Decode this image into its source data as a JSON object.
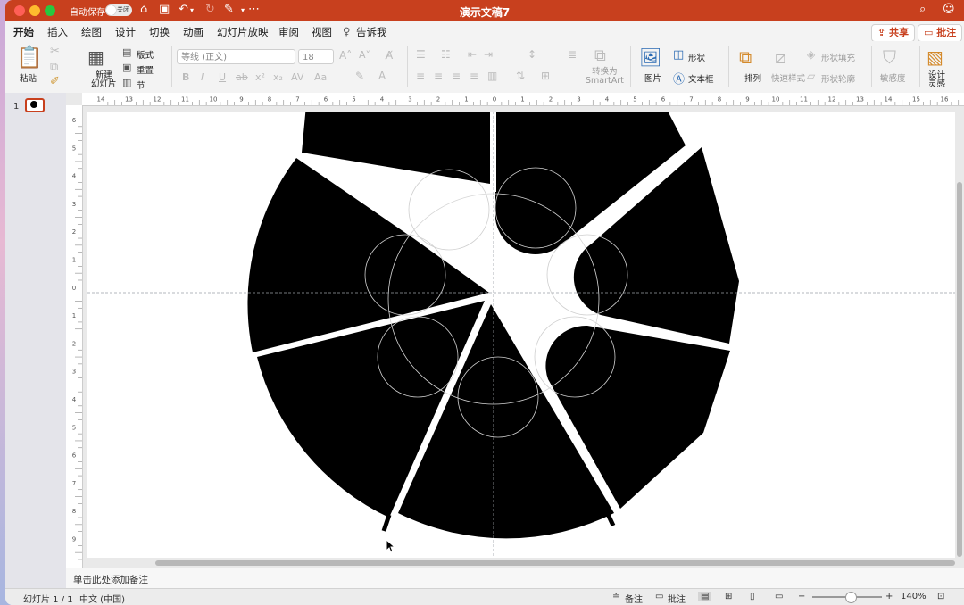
{
  "titlebar": {
    "autosave_label": "自动保存",
    "autosave_state": "关闭",
    "doc_title": "演示文稿7"
  },
  "tabs": [
    {
      "label": "开始",
      "active": true
    },
    {
      "label": "插入"
    },
    {
      "label": "绘图"
    },
    {
      "label": "设计"
    },
    {
      "label": "切换"
    },
    {
      "label": "动画"
    },
    {
      "label": "幻灯片放映"
    },
    {
      "label": "审阅"
    },
    {
      "label": "视图"
    },
    {
      "label": "告诉我"
    }
  ],
  "actions": {
    "share": "共享",
    "comment": "批注"
  },
  "ribbon": {
    "paste": "粘贴",
    "new_slide_1": "新建",
    "new_slide_2": "幻灯片",
    "layout": "版式",
    "reset": "重置",
    "section": "节",
    "font_name": "等线 (正文)",
    "font_size": "18",
    "convert_1": "转换为",
    "convert_2": "SmartArt",
    "picture": "图片",
    "shape": "形状",
    "textbox": "文本框",
    "arrange": "排列",
    "quick_styles": "快速样式",
    "shape_fill": "形状填充",
    "shape_outline": "形状轮廓",
    "sensitivity": "敏感度",
    "designer_1": "设计",
    "designer_2": "灵感"
  },
  "thumbnails": {
    "slide_number": "1"
  },
  "notes": {
    "placeholder": "单击此处添加备注"
  },
  "status": {
    "slide_info": "幻灯片 1 / 1",
    "language": "中文 (中国)",
    "notes": "备注",
    "comments": "批注",
    "zoom": "140%",
    "zoom_level": 0.55
  },
  "ruler": {
    "h_labels": [
      "14",
      "13",
      "12",
      "11",
      "10",
      "9",
      "8",
      "7",
      "6",
      "5",
      "4",
      "3",
      "2",
      "1",
      "0",
      "1",
      "2",
      "3",
      "4",
      "5",
      "6",
      "7",
      "8",
      "9",
      "10",
      "11",
      "12",
      "13",
      "14",
      "15",
      "16"
    ],
    "v_labels": [
      "6",
      "5",
      "4",
      "3",
      "2",
      "1",
      "0",
      "1",
      "2",
      "3",
      "4",
      "5",
      "6",
      "7",
      "8",
      "9"
    ]
  },
  "colors": {
    "accent": "#c8401e",
    "shape_fill": "#000000"
  }
}
